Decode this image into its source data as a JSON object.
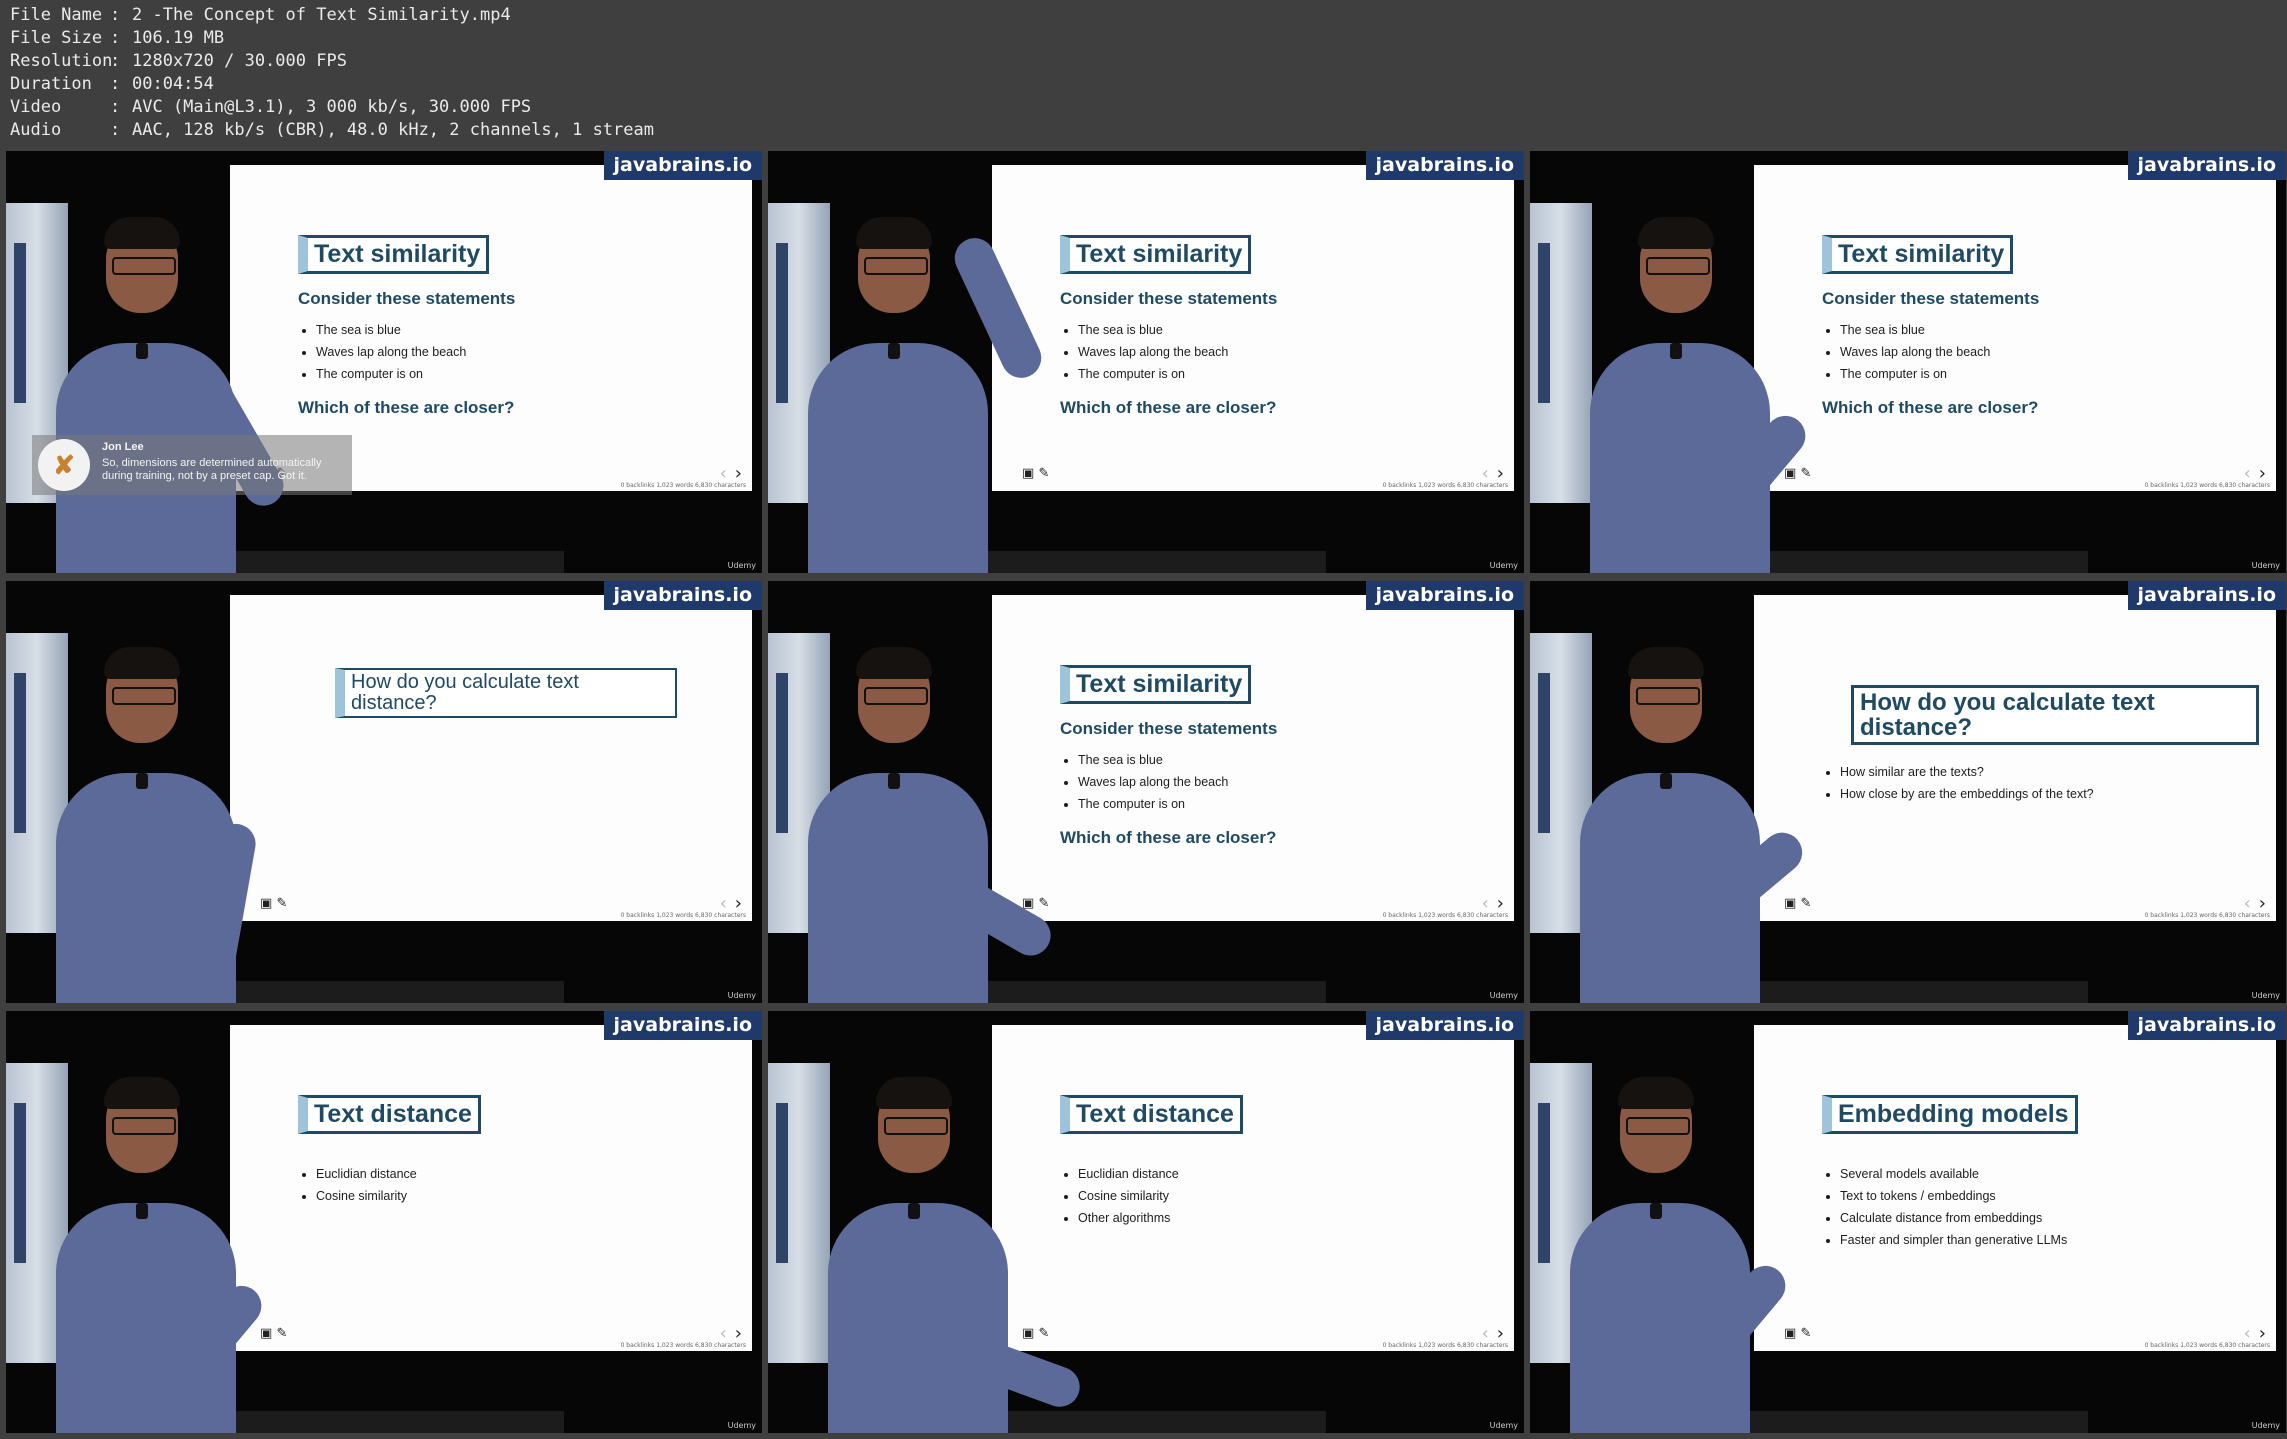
{
  "info": [
    {
      "key": "File Name",
      "value": "2 -The Concept of Text Similarity.mp4"
    },
    {
      "key": "File Size",
      "value": "106.19 MB"
    },
    {
      "key": "Resolution",
      "value": "1280x720 / 30.000 FPS"
    },
    {
      "key": "Duration",
      "value": "00:04:54"
    },
    {
      "key": "Video",
      "value": "AVC (Main@L3.1), 3 000 kb/s, 30.000 FPS"
    },
    {
      "key": "Audio",
      "value": "AAC, 128 kb/s (CBR), 48.0 kHz, 2 channels, 1 stream"
    }
  ],
  "brand": "javabrains.io",
  "watermark": "Udemy",
  "statusbar": "0 backlinks   1,023 words   6,830 characters",
  "caption": {
    "name": "Jon Lee",
    "message": "So, dimensions are determined automatically during training, not by a preset cap. Got it."
  },
  "frames": [
    {
      "title": "Text similarity",
      "subtitle": "Consider these statements",
      "bullets": [
        "The sea is blue",
        "Waves lap along the beach",
        "The computer is on"
      ],
      "question": "Which of these are closer?"
    },
    {
      "title": "Text similarity",
      "subtitle": "Consider these statements",
      "bullets": [
        "The sea is blue",
        "Waves lap along the beach",
        "The computer is on"
      ],
      "question": "Which of these are closer?"
    },
    {
      "title": "Text similarity",
      "subtitle": "Consider these statements",
      "bullets": [
        "The sea is blue",
        "Waves lap along the beach",
        "The computer is on"
      ],
      "question": "Which of these are closer?"
    },
    {
      "title": "How do you calculate text distance?",
      "subtitle": "",
      "bullets": [],
      "question": ""
    },
    {
      "title": "Text similarity",
      "subtitle": "Consider these statements",
      "bullets": [
        "The sea is blue",
        "Waves lap along the beach",
        "The computer is on"
      ],
      "question": "Which of these are closer?"
    },
    {
      "title": "How do you calculate text distance?",
      "subtitle": "",
      "bullets": [
        "How similar are the texts?",
        "How close by are the embeddings of the text?"
      ],
      "question": ""
    },
    {
      "title": "Text distance",
      "subtitle": "",
      "bullets": [
        "Euclidian distance",
        "Cosine similarity"
      ],
      "question": ""
    },
    {
      "title": "Text distance",
      "subtitle": "",
      "bullets": [
        "Euclidian distance",
        "Cosine similarity",
        "Other algorithms"
      ],
      "question": ""
    },
    {
      "title": "Embedding models",
      "subtitle": "",
      "bullets": [
        "Several models available",
        "Text to tokens / embeddings",
        "Calculate distance from embeddings",
        "Faster and simpler than generative LLMs"
      ],
      "question": ""
    }
  ]
}
